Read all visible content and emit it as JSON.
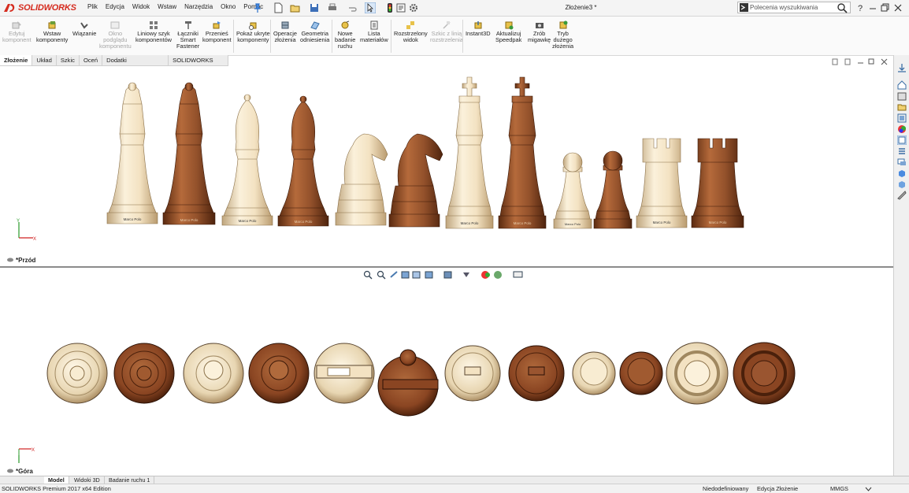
{
  "app": {
    "brand": "SOLIDWORKS",
    "document_title": "Złożenie3 *"
  },
  "menu": [
    "Plik",
    "Edycja",
    "Widok",
    "Wstaw",
    "Narzędzia",
    "Okno",
    "Pomoc"
  ],
  "search": {
    "placeholder": "Polecenia wyszukiwania"
  },
  "commands": [
    {
      "label": "Edytuj\nkomponent",
      "enabled": false,
      "icon": "edit-component-icon"
    },
    {
      "label": "Wstaw\nkomponenty",
      "enabled": true,
      "icon": "insert-components-icon"
    },
    {
      "label": "Wiązanie",
      "enabled": true,
      "icon": "mate-icon"
    },
    {
      "label": "Okno\npodglądu\nkomponentu",
      "enabled": false,
      "icon": "preview-window-icon"
    },
    {
      "label": "Liniowy szyk\nkomponentów",
      "enabled": true,
      "icon": "linear-pattern-icon"
    },
    {
      "label": "Łączniki\nSmart\nFastener",
      "enabled": true,
      "icon": "smart-fastener-icon"
    },
    {
      "label": "Przenieś\nkomponent",
      "enabled": true,
      "icon": "move-component-icon"
    },
    {
      "label": "Pokaż ukryte\nkomponenty",
      "enabled": true,
      "icon": "show-hidden-icon"
    },
    {
      "label": "Operacje\nzłożenia",
      "enabled": true,
      "icon": "assembly-features-icon"
    },
    {
      "label": "Geometria\nodniesienia",
      "enabled": true,
      "icon": "reference-geometry-icon"
    },
    {
      "label": "Nowe\nbadanie\nruchu",
      "enabled": true,
      "icon": "motion-study-icon"
    },
    {
      "label": "Lista\nmateriałów",
      "enabled": true,
      "icon": "bom-icon"
    },
    {
      "label": "Rozstrzelony\nwidok",
      "enabled": true,
      "icon": "exploded-view-icon"
    },
    {
      "label": "Szkic z linią\nrozstrzelenia",
      "enabled": false,
      "icon": "explode-line-sketch-icon"
    },
    {
      "label": "Instant3D",
      "enabled": true,
      "icon": "instant3d-icon"
    },
    {
      "label": "Aktualizuj\nSpeedpak",
      "enabled": true,
      "icon": "speedpak-icon"
    },
    {
      "label": "Zrób\nmigawkę",
      "enabled": true,
      "icon": "camera-icon"
    },
    {
      "label": "Tryb\ndużego\nzłożenia",
      "enabled": true,
      "icon": "large-assembly-icon"
    }
  ],
  "cm_tabs": [
    {
      "label": "Złożenie",
      "active": true
    },
    {
      "label": "Układ",
      "active": false
    },
    {
      "label": "Szkic",
      "active": false
    },
    {
      "label": "Oceń",
      "active": false
    },
    {
      "label": "Dodatki SOLIDWORKS",
      "active": false
    },
    {
      "label": "SOLIDWORKS MBD",
      "active": false
    }
  ],
  "viewports": {
    "top_view_label": "*Przód",
    "bottom_view_label": "*Góra"
  },
  "axes": {
    "x": "X",
    "y": "Y"
  },
  "piece_engraving": "Marco Polo",
  "colors": {
    "light_wood": "#ecdcbc",
    "dark_wood": "#8b4a26",
    "brand_red": "#d52b1e",
    "splitter": "#8c8c8c"
  },
  "bottom_tabs": [
    {
      "label": "Model",
      "active": true
    },
    {
      "label": "Widoki 3D",
      "active": false
    },
    {
      "label": "Badanie ruchu 1",
      "active": false
    }
  ],
  "status": {
    "edition": "SOLIDWORKS Premium 2017 x64 Edition",
    "state": "Niedodefiniowany",
    "mode": "Edycja Złożenie",
    "units": "MMGS"
  }
}
